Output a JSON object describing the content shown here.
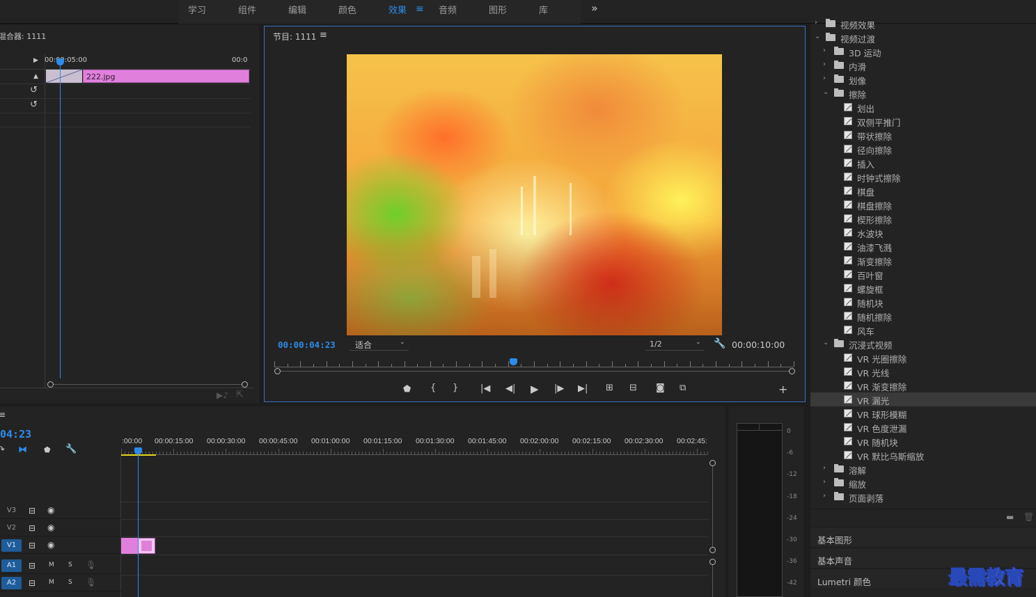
{
  "workspaces": {
    "items": [
      "学习",
      "组件",
      "编辑",
      "颜色",
      "效果",
      "音频",
      "图形",
      "库"
    ],
    "active": "效果",
    "overflow": "»"
  },
  "effect_controls": {
    "title": "混合器: 1111",
    "ruler_start": "00:00:05:00",
    "ruler_end": "00:0",
    "clip_label": "222.jpg"
  },
  "program": {
    "title": "节目: 1111",
    "timecode": "00:00:04:23",
    "zoom": "适合",
    "resolution": "1/2",
    "duration": "00:00:10:00",
    "playhead_fraction": 0.46
  },
  "timeline": {
    "timecode": "04:23",
    "ruler": [
      ":00:00",
      "00:00:15:00",
      "00:00:30:00",
      "00:00:45:00",
      "00:01:00:00",
      "00:01:15:00",
      "00:01:30:00",
      "00:01:45:00",
      "00:02:00:00",
      "00:02:15:00",
      "00:02:30:00",
      "00:02:45:"
    ],
    "tracks": [
      {
        "name": "V3",
        "type": "video"
      },
      {
        "name": "V2",
        "type": "video"
      },
      {
        "name": "V1",
        "type": "video",
        "targeted": true
      },
      {
        "name": "A1",
        "type": "audio",
        "targeted": true
      },
      {
        "name": "A2",
        "type": "audio",
        "targeted": true
      }
    ],
    "mute": "M",
    "solo": "S"
  },
  "meter": {
    "scale": [
      "0",
      "-6",
      "-12",
      "-18",
      "-24",
      "-30",
      "-36",
      "-42"
    ]
  },
  "effects_panel": {
    "tree": [
      {
        "label": "视频效果",
        "kind": "folder",
        "level": 0,
        "open": false
      },
      {
        "label": "视频过渡",
        "kind": "folder",
        "level": 0,
        "open": true
      },
      {
        "label": "3D 运动",
        "kind": "folder",
        "level": 1,
        "open": false
      },
      {
        "label": "内滑",
        "kind": "folder",
        "level": 1,
        "open": false
      },
      {
        "label": "划像",
        "kind": "folder",
        "level": 1,
        "open": false
      },
      {
        "label": "擦除",
        "kind": "folder",
        "level": 1,
        "open": true
      },
      {
        "label": "划出",
        "kind": "item",
        "level": 2
      },
      {
        "label": "双侧平推门",
        "kind": "item",
        "level": 2
      },
      {
        "label": "带状擦除",
        "kind": "item",
        "level": 2
      },
      {
        "label": "径向擦除",
        "kind": "item",
        "level": 2
      },
      {
        "label": "插入",
        "kind": "item",
        "level": 2
      },
      {
        "label": "时钟式擦除",
        "kind": "item",
        "level": 2
      },
      {
        "label": "棋盘",
        "kind": "item",
        "level": 2
      },
      {
        "label": "棋盘擦除",
        "kind": "item",
        "level": 2
      },
      {
        "label": "楔形擦除",
        "kind": "item",
        "level": 2
      },
      {
        "label": "水波块",
        "kind": "item",
        "level": 2
      },
      {
        "label": "油漆飞溅",
        "kind": "item",
        "level": 2
      },
      {
        "label": "渐变擦除",
        "kind": "item",
        "level": 2
      },
      {
        "label": "百叶窗",
        "kind": "item",
        "level": 2
      },
      {
        "label": "螺旋框",
        "kind": "item",
        "level": 2
      },
      {
        "label": "随机块",
        "kind": "item",
        "level": 2
      },
      {
        "label": "随机擦除",
        "kind": "item",
        "level": 2
      },
      {
        "label": "风车",
        "kind": "item",
        "level": 2
      },
      {
        "label": "沉浸式视频",
        "kind": "folder",
        "level": 1,
        "open": true
      },
      {
        "label": "VR 光圈擦除",
        "kind": "item",
        "level": 2
      },
      {
        "label": "VR 光线",
        "kind": "item",
        "level": 2
      },
      {
        "label": "VR 渐变擦除",
        "kind": "item",
        "level": 2
      },
      {
        "label": "VR 漏光",
        "kind": "item",
        "level": 2,
        "selected": true
      },
      {
        "label": "VR 球形模糊",
        "kind": "item",
        "level": 2
      },
      {
        "label": "VR 色度泄漏",
        "kind": "item",
        "level": 2
      },
      {
        "label": "VR 随机块",
        "kind": "item",
        "level": 2
      },
      {
        "label": "VR 默比乌斯缩放",
        "kind": "item",
        "level": 2
      },
      {
        "label": "溶解",
        "kind": "folder",
        "level": 1,
        "open": false
      },
      {
        "label": "缩放",
        "kind": "folder",
        "level": 1,
        "open": false
      },
      {
        "label": "页面剥落",
        "kind": "folder",
        "level": 1,
        "open": false
      }
    ],
    "sections": [
      "基本图形",
      "基本声音",
      "Lumetri 颜色"
    ]
  },
  "watermark": "最需教育",
  "colors": {
    "accent": "#2d8ceb",
    "clip": "#e080dc",
    "panel": "#232323"
  }
}
